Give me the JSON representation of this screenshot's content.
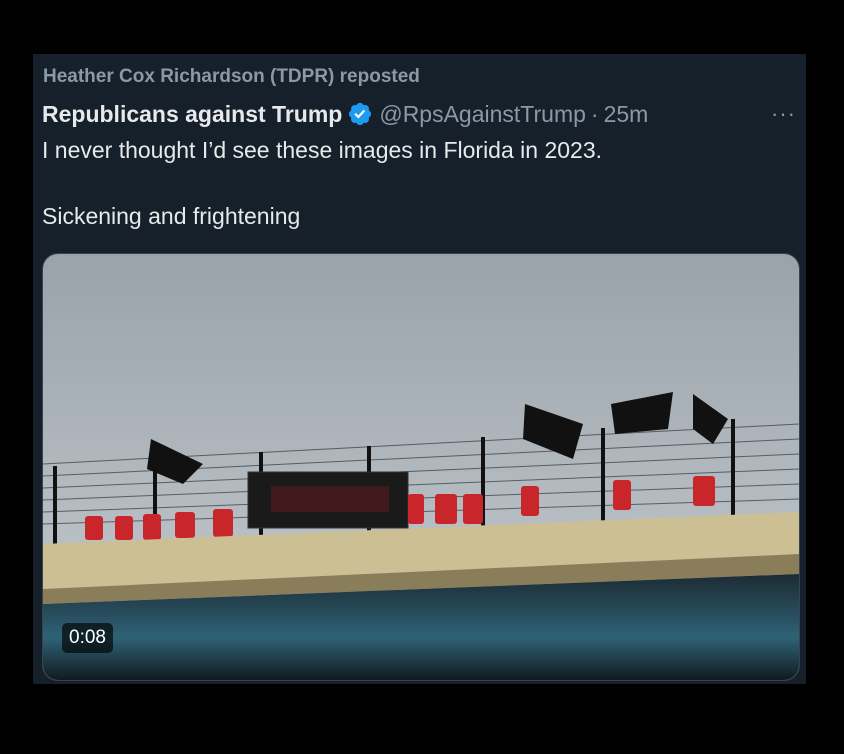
{
  "repost": {
    "text": "Heather Cox Richardson (TDPR) reposted"
  },
  "tweet": {
    "author_name": "Republicans against Trump",
    "verified_icon": "verified-badge-icon",
    "handle": "@RpsAgainstTrump",
    "separator": "·",
    "time": "25m",
    "more_icon": "more-horizontal-icon",
    "more_label": "···",
    "text_line1": "I never thought I’d see these images in Florida in 2023.",
    "text_line2": "Sickening and frightening"
  },
  "media": {
    "type": "video",
    "duration": "0:08"
  },
  "colors": {
    "background": "#15202b",
    "text": "#e7e9ea",
    "muted": "#8b98a5",
    "verified": "#1d9bf0"
  }
}
